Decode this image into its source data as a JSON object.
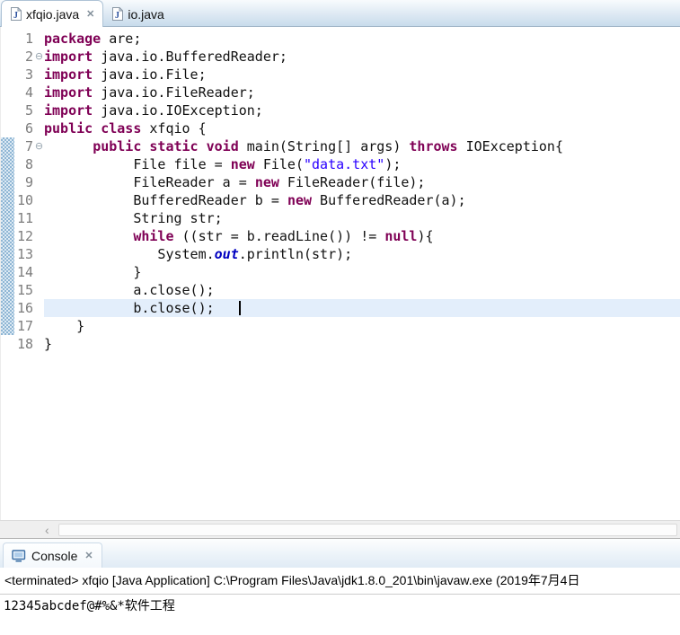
{
  "editor": {
    "tabs": [
      {
        "label": "xfqio.java",
        "icon": "java-file-icon",
        "active": true,
        "closable": true
      },
      {
        "label": "io.java",
        "icon": "java-file-icon",
        "active": false,
        "closable": false
      }
    ],
    "lines": [
      {
        "num": "1",
        "fold": false,
        "changed": false,
        "current": false,
        "segs": [
          [
            "k",
            "package"
          ],
          [
            "p",
            " are;"
          ]
        ]
      },
      {
        "num": "2",
        "fold": true,
        "changed": false,
        "current": false,
        "segs": [
          [
            "k",
            "import"
          ],
          [
            "p",
            " java.io.BufferedReader;"
          ]
        ]
      },
      {
        "num": "3",
        "fold": false,
        "changed": false,
        "current": false,
        "segs": [
          [
            "k",
            "import"
          ],
          [
            "p",
            " java.io.File;"
          ]
        ]
      },
      {
        "num": "4",
        "fold": false,
        "changed": false,
        "current": false,
        "segs": [
          [
            "k",
            "import"
          ],
          [
            "p",
            " java.io.FileReader;"
          ]
        ]
      },
      {
        "num": "5",
        "fold": false,
        "changed": false,
        "current": false,
        "segs": [
          [
            "k",
            "import"
          ],
          [
            "p",
            " java.io.IOException;"
          ]
        ]
      },
      {
        "num": "6",
        "fold": false,
        "changed": false,
        "current": false,
        "segs": [
          [
            "k",
            "public"
          ],
          [
            "p",
            " "
          ],
          [
            "k",
            "class"
          ],
          [
            "p",
            " xfqio {"
          ]
        ]
      },
      {
        "num": "7",
        "fold": true,
        "changed": true,
        "current": false,
        "segs": [
          [
            "p",
            "      "
          ],
          [
            "k",
            "public"
          ],
          [
            "p",
            " "
          ],
          [
            "k",
            "static"
          ],
          [
            "p",
            " "
          ],
          [
            "k",
            "void"
          ],
          [
            "p",
            " main(String[] args) "
          ],
          [
            "k",
            "throws"
          ],
          [
            "p",
            " IOException{"
          ]
        ]
      },
      {
        "num": "8",
        "fold": false,
        "changed": true,
        "current": false,
        "segs": [
          [
            "p",
            "           File file = "
          ],
          [
            "k",
            "new"
          ],
          [
            "p",
            " File("
          ],
          [
            "s",
            "\"data.txt\""
          ],
          [
            "p",
            ");"
          ]
        ]
      },
      {
        "num": "9",
        "fold": false,
        "changed": true,
        "current": false,
        "segs": [
          [
            "p",
            "           FileReader a = "
          ],
          [
            "k",
            "new"
          ],
          [
            "p",
            " FileReader(file);"
          ]
        ]
      },
      {
        "num": "10",
        "fold": false,
        "changed": true,
        "current": false,
        "segs": [
          [
            "p",
            "           BufferedReader b = "
          ],
          [
            "k",
            "new"
          ],
          [
            "p",
            " BufferedReader(a);"
          ]
        ]
      },
      {
        "num": "11",
        "fold": false,
        "changed": true,
        "current": false,
        "segs": [
          [
            "p",
            "           String str;"
          ]
        ]
      },
      {
        "num": "12",
        "fold": false,
        "changed": true,
        "current": false,
        "segs": [
          [
            "p",
            "           "
          ],
          [
            "k",
            "while"
          ],
          [
            "p",
            " ((str = b.readLine()) != "
          ],
          [
            "k",
            "null"
          ],
          [
            "p",
            "){"
          ]
        ]
      },
      {
        "num": "13",
        "fold": false,
        "changed": true,
        "current": false,
        "segs": [
          [
            "p",
            "              System."
          ],
          [
            "f",
            "out"
          ],
          [
            "p",
            ".println(str);"
          ]
        ]
      },
      {
        "num": "14",
        "fold": false,
        "changed": true,
        "current": false,
        "segs": [
          [
            "p",
            "           }"
          ]
        ]
      },
      {
        "num": "15",
        "fold": false,
        "changed": true,
        "current": false,
        "segs": [
          [
            "p",
            "           a.close();"
          ]
        ]
      },
      {
        "num": "16",
        "fold": false,
        "changed": true,
        "current": true,
        "cursor": true,
        "segs": [
          [
            "p",
            "           b.close();   "
          ]
        ]
      },
      {
        "num": "17",
        "fold": false,
        "changed": true,
        "current": false,
        "segs": [
          [
            "p",
            "    }"
          ]
        ]
      },
      {
        "num": "18",
        "fold": false,
        "changed": false,
        "current": false,
        "segs": [
          [
            "p",
            "}"
          ]
        ]
      }
    ]
  },
  "console": {
    "tab_label": "Console",
    "status_line": "<terminated> xfqio [Java Application] C:\\Program Files\\Java\\jdk1.8.0_201\\bin\\javaw.exe (2019年7月4日 ",
    "output": "12345abcdef@#%&*软件工程"
  },
  "icons": {
    "close": "✕",
    "fold_collapsed": "⊖",
    "scroll_left": "‹"
  },
  "colors": {
    "keyword": "#7f0055",
    "string": "#2a00ff",
    "static_field": "#0000c0",
    "line_number": "#7d7d7d",
    "current_line_bg": "#e3eefb",
    "change_bar": "#8fb6d4",
    "tabbar_bg": "#cfe0ee"
  }
}
